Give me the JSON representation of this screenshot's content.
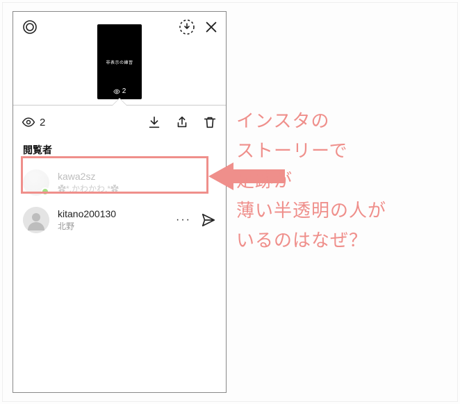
{
  "story": {
    "caption": "非表示の練習",
    "thumb_views": "2"
  },
  "toolbar": {
    "view_count": "2"
  },
  "section": {
    "title": "閲覧者"
  },
  "viewers": [
    {
      "name": "kawa2sz",
      "sub": "✿*.かわかわ.*✿",
      "faded": true,
      "online": true,
      "default_avatar": false
    },
    {
      "name": "kitano200130",
      "sub": "北野",
      "faded": false,
      "online": false,
      "default_avatar": true
    }
  ],
  "annotation": {
    "lines": [
      "インスタの",
      "ストーリーで",
      "足跡が",
      "薄い半透明の人が",
      "いるのはなぜ？"
    ]
  },
  "colors": {
    "accent": "#ef8f8b"
  }
}
